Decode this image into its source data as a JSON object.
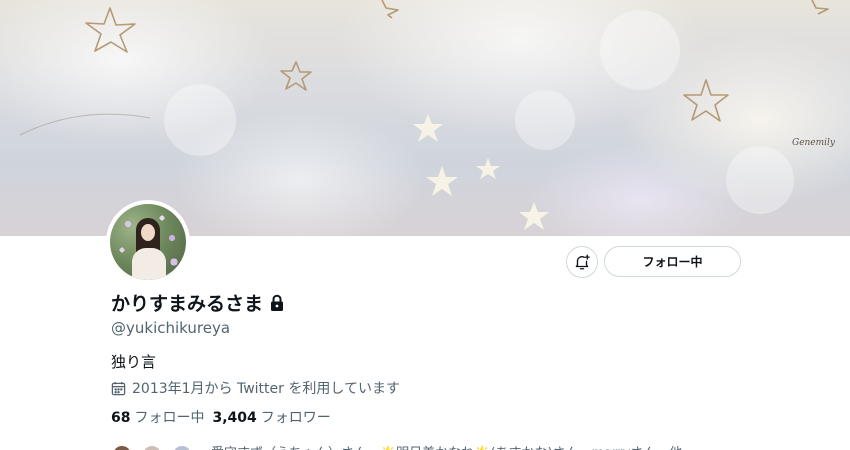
{
  "banner": {
    "signature": "Genemily",
    "icon": "star-doodle-icon"
  },
  "profile": {
    "display_name": "かりすまみるさま",
    "protected_icon": "lock-icon",
    "handle": "@yukichikureya",
    "bio": "独り言",
    "joined_icon": "calendar-icon",
    "joined_text": "2013年1月から Twitter を利用しています",
    "following_count": "68",
    "following_label": "フォロー中",
    "followers_count": "3,404",
    "followers_label": "フォロワー",
    "known_followers_text": "愛守すず（えちゃん）さん、🌟明日美かなね🌟(あすかな)さん、marryさん、他"
  },
  "actions": {
    "notify_icon": "bell-plus-icon",
    "follow_label": "フォロー中"
  },
  "colors": {
    "text_primary": "#0f1419",
    "text_secondary": "#536471",
    "border": "#cfd9de"
  }
}
